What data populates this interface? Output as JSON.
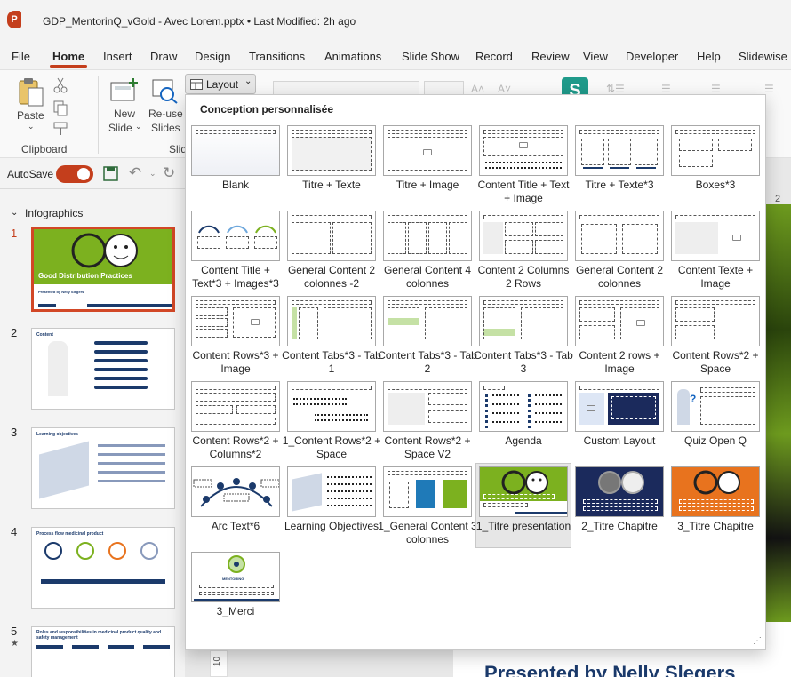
{
  "app": {
    "logo_letter": "P",
    "document_title": "GDP_MentorinQ_vGold - Avec Lorem.pptx  •  Last Modified: 2h ago"
  },
  "menu": {
    "tabs": [
      "File",
      "Home",
      "Insert",
      "Draw",
      "Design",
      "Transitions",
      "Animations",
      "Slide Show",
      "Record",
      "Review",
      "View",
      "Developer",
      "Help",
      "Slidewise"
    ],
    "active": "Home"
  },
  "ribbon": {
    "paste": "Paste",
    "clipboard_group": "Clipboard",
    "new_slide": "New",
    "new_slide_2": "Slide",
    "reuse": "Re-use",
    "reuse_2": "Slides",
    "slides_group": "Slid",
    "layout_button": "Layout"
  },
  "autosave": {
    "label": "AutoSave",
    "state": "on"
  },
  "slide_panel": {
    "section": "Infographics",
    "slides": [
      {
        "num": "1",
        "title": "Good Distribution Practices",
        "subtitle": "Presented by Nelly Slegers"
      },
      {
        "num": "2",
        "title": "Content"
      },
      {
        "num": "3",
        "title": "Learning objectives"
      },
      {
        "num": "4",
        "title": "Process flow medicinal product"
      },
      {
        "num": "5",
        "title": "Roles and responsibilities in medicinal product quality and safety management"
      }
    ]
  },
  "canvas": {
    "peek_text": "Presented by Nelly Slegers",
    "ruler_mark": "10"
  },
  "layout_popup": {
    "header": "Conception personnalisée",
    "layouts": [
      "Blank",
      "Titre + Texte",
      "Titre + Image",
      "Content Title + Text + Image",
      "Titre + Texte*3",
      "Boxes*3",
      "Content Title + Text*3 + Images*3",
      "General Content 2 colonnes -2",
      "General Content 4 colonnes",
      "Content 2 Columns 2 Rows",
      "General Content 2 colonnes",
      "Content Texte + Image",
      "Content Rows*3 + Image",
      "Content Tabs*3 - Tab 1",
      "Content Tabs*3 - Tab 2",
      "Content Tabs*3 - Tab 3",
      "Content 2 rows + Image",
      "Content Rows*2 + Space",
      "Content Rows*2 + Columns*2",
      "1_Content Rows*2 + Space",
      "Content Rows*2 + Space V2",
      "Agenda",
      "Custom Layout",
      "Quiz Open Q",
      "Arc Text*6",
      "Learning Objectives",
      "1_General Content 3 colonnes",
      "1_Titre presentation",
      "2_Titre Chapitre",
      "3_Titre Chapitre",
      "3_Merci"
    ],
    "selected": "1_Titre presentation",
    "merci_logo_text": "MENTORING"
  },
  "colors": {
    "accent": "#c43e1c",
    "brand_green": "#7cb11f",
    "navy": "#1b2a5c",
    "orange": "#e8731e"
  }
}
